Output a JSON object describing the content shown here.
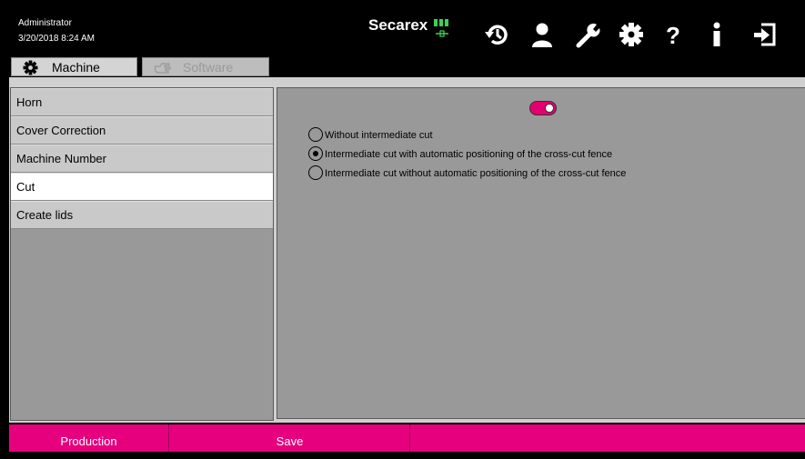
{
  "header": {
    "user": "Administrator",
    "datetime": "3/20/2018 8:24 AM",
    "brand": "Secarex",
    "icons": [
      "history-icon",
      "user-icon",
      "wrench-icon",
      "gear-icon",
      "help-icon",
      "info-icon",
      "logout-icon"
    ]
  },
  "tabs": [
    {
      "label": "Machine",
      "icon": "gear-icon",
      "active": true
    },
    {
      "label": "Software",
      "icon": "hand-icon",
      "active": false
    }
  ],
  "sidebar": {
    "items": [
      {
        "label": "Horn"
      },
      {
        "label": "Cover Correction"
      },
      {
        "label": "Machine Number"
      },
      {
        "label": "Cut",
        "selected": true
      },
      {
        "label": "Create lids"
      }
    ]
  },
  "content": {
    "toggle_on": true,
    "options": [
      {
        "label": "Without intermediate cut",
        "checked": false
      },
      {
        "label": "Intermediate cut with automatic positioning of the cross-cut fence",
        "checked": true
      },
      {
        "label": "Intermediate cut without automatic positioning of the cross-cut fence",
        "checked": false
      }
    ]
  },
  "footer": {
    "production_label": "Production",
    "save_label": "Save"
  },
  "colors": {
    "accent": "#e6007e",
    "panel": "#999999",
    "menu_item": "#c9c9c9",
    "brand_green": "#39d353"
  }
}
